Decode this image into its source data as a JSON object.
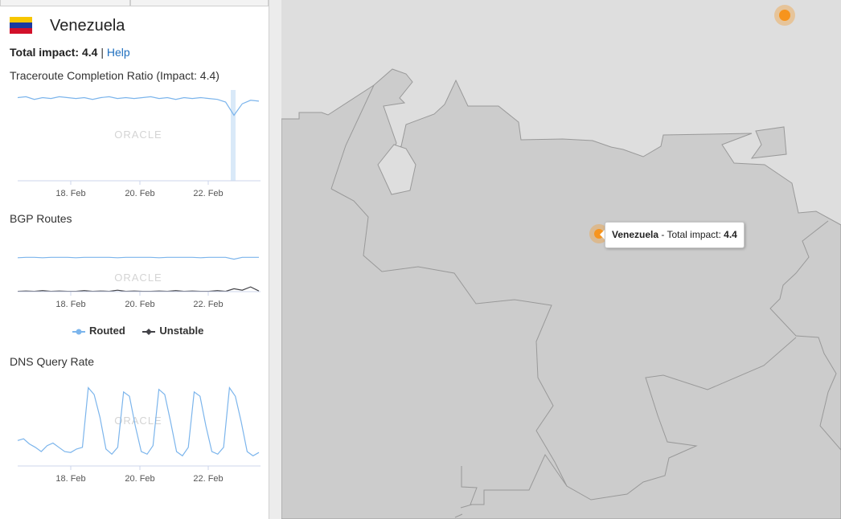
{
  "country": {
    "name": "Venezuela",
    "flag_colors": [
      "#f7c600",
      "#1a3aa0",
      "#d2102a"
    ]
  },
  "impact": {
    "label": "Total impact:",
    "value": "4.4",
    "separator": "|",
    "help_label": "Help"
  },
  "sections": {
    "traceroute_title": "Traceroute Completion Ratio (Impact: 4.4)",
    "bgp_title": "BGP Routes",
    "dns_title": "DNS Query Rate"
  },
  "watermark": "ORACLE",
  "x_ticks": [
    "18. Feb",
    "20. Feb",
    "22. Feb"
  ],
  "bgp_legend": [
    {
      "label": "Routed",
      "color": "#7cb5ec",
      "icon": "circle-marker"
    },
    {
      "label": "Unstable",
      "color": "#434348",
      "icon": "diamond-marker"
    }
  ],
  "chart_data": [
    {
      "type": "line",
      "title": "Traceroute Completion Ratio (Impact: 4.4)",
      "categories": [
        "18. Feb",
        "20. Feb",
        "22. Feb"
      ],
      "series": [
        {
          "color": "#7cb5ec",
          "values": [
            0.95,
            0.96,
            0.93,
            0.95,
            0.94,
            0.96,
            0.95,
            0.94,
            0.95,
            0.93,
            0.95,
            0.96,
            0.94,
            0.95,
            0.94,
            0.95,
            0.96,
            0.94,
            0.95,
            0.93,
            0.95,
            0.94,
            0.95,
            0.94,
            0.93,
            0.9,
            0.75,
            0.88,
            0.92,
            0.91
          ]
        }
      ],
      "highlight_band": "22. Feb – 23. Feb"
    },
    {
      "type": "line",
      "title": "BGP Routes",
      "categories": [
        "18. Feb",
        "20. Feb",
        "22. Feb"
      ],
      "series": [
        {
          "name": "Routed",
          "color": "#7cb5ec",
          "values": [
            0.94,
            0.95,
            0.95,
            0.94,
            0.95,
            0.95,
            0.95,
            0.94,
            0.95,
            0.95,
            0.95,
            0.95,
            0.94,
            0.95,
            0.95,
            0.95,
            0.95,
            0.94,
            0.95,
            0.95,
            0.95,
            0.95,
            0.94,
            0.95,
            0.95,
            0.95,
            0.9,
            0.95,
            0.95,
            0.95
          ]
        },
        {
          "name": "Unstable",
          "color": "#434348",
          "values": [
            0.03,
            0.04,
            0.03,
            0.05,
            0.03,
            0.04,
            0.03,
            0.03,
            0.05,
            0.03,
            0.04,
            0.03,
            0.06,
            0.03,
            0.04,
            0.03,
            0.03,
            0.04,
            0.03,
            0.05,
            0.03,
            0.04,
            0.03,
            0.03,
            0.05,
            0.03,
            0.1,
            0.06,
            0.15,
            0.04
          ]
        }
      ]
    },
    {
      "type": "line",
      "title": "DNS Query Rate",
      "categories": [
        "18. Feb",
        "20. Feb",
        "22. Feb"
      ],
      "series": [
        {
          "color": "#7cb5ec",
          "values": [
            0.28,
            0.3,
            0.24,
            0.2,
            0.15,
            0.22,
            0.25,
            0.2,
            0.15,
            0.14,
            0.18,
            0.2,
            0.9,
            0.82,
            0.55,
            0.18,
            0.12,
            0.2,
            0.85,
            0.8,
            0.45,
            0.15,
            0.12,
            0.22,
            0.88,
            0.82,
            0.5,
            0.15,
            0.1,
            0.2,
            0.85,
            0.8,
            0.45,
            0.15,
            0.12,
            0.2,
            0.9,
            0.8,
            0.5,
            0.15,
            0.1,
            0.14
          ]
        }
      ]
    }
  ],
  "map": {
    "tooltip_name": "Venezuela",
    "tooltip_sep": " - Total impact: ",
    "tooltip_value": "4.4",
    "marker_color": "#f7941d",
    "land_color": "#cccccc",
    "sea_color": "#dedede",
    "border_color": "#999999"
  }
}
